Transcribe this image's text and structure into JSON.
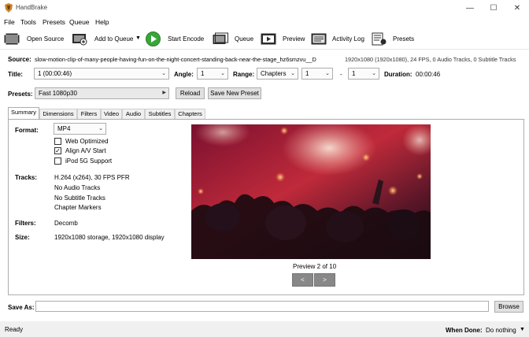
{
  "window": {
    "title": "HandBrake",
    "minimize_glyph": "—",
    "maximize_glyph": "☐",
    "close_glyph": "✕"
  },
  "menu": [
    "File",
    "Tools",
    "Presets",
    "Queue",
    "Help"
  ],
  "toolbar": {
    "open_source": "Open Source",
    "add_to_queue": "Add to Queue",
    "start_encode": "Start Encode",
    "queue": "Queue",
    "preview": "Preview",
    "activity_log": "Activity Log",
    "presets": "Presets"
  },
  "source": {
    "label": "Source:",
    "filename": "slow-motion-clip-of-many-people-having-fun-on-the-night-concert-standing-back-near-the-stage_hz6smzvu__D",
    "info": "1920x1080 (1920x1080), 24 FPS, 0 Audio Tracks, 0 Subtitle Tracks"
  },
  "title_row": {
    "title_label": "Title:",
    "title_value": "1 (00:00:46)",
    "angle_label": "Angle:",
    "angle_value": "1",
    "range_label": "Range:",
    "range_value": "Chapters",
    "range_start": "1",
    "range_dash": "-",
    "range_end": "1",
    "duration_label": "Duration:",
    "duration_value": "00:00:46"
  },
  "presets_row": {
    "label": "Presets:",
    "value": "Fast 1080p30",
    "reload": "Reload",
    "save_new": "Save New Preset"
  },
  "tabs": [
    "Summary",
    "Dimensions",
    "Filters",
    "Video",
    "Audio",
    "Subtitles",
    "Chapters"
  ],
  "summary": {
    "format_label": "Format:",
    "format_value": "MP4",
    "web_optimized": "Web Optimized",
    "align_av": "Align A/V Start",
    "ipod": "iPod 5G Support",
    "web_optimized_checked": false,
    "align_av_checked": true,
    "ipod_checked": false,
    "tracks_label": "Tracks:",
    "tracks": [
      "H.264 (x264), 30 FPS PFR",
      "No Audio Tracks",
      "No Subtitle Tracks",
      "Chapter Markers"
    ],
    "filters_label": "Filters:",
    "filters_value": "Decomb",
    "size_label": "Size:",
    "size_value": "1920x1080 storage, 1920x1080 display",
    "preview_caption": "Preview 2 of 10",
    "prev_glyph": "<",
    "next_glyph": ">"
  },
  "save_as": {
    "label": "Save As:",
    "value": "",
    "browse": "Browse"
  },
  "status": {
    "text": "Ready",
    "when_done_label": "When Done:",
    "when_done_value": "Do nothing"
  },
  "colors": {
    "start_encode_green": "#3aa53a",
    "accent": "#0078d7"
  }
}
